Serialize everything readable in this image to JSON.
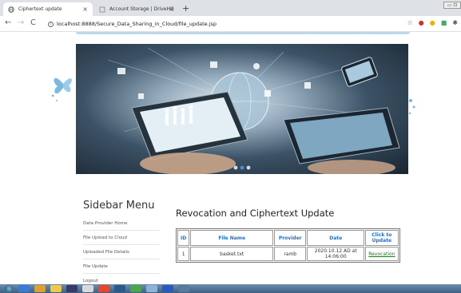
{
  "browser": {
    "tabs": [
      {
        "label": "Ciphertext update",
        "active": true
      },
      {
        "label": "Account Storage | DriveHQ",
        "active": false
      }
    ],
    "new_tab": "+",
    "url": "localhost:8888/Secure_Data_Sharing_in_Cloud/file_update.jsp",
    "window_controls": "▭ ⊡"
  },
  "sidebar": {
    "title": "Sidebar Menu",
    "items": [
      {
        "label": "Data Provider Home"
      },
      {
        "label": "File Upload to Cloud"
      },
      {
        "label": "Uploaded File Details"
      },
      {
        "label": "File Update"
      },
      {
        "label": "Logout"
      }
    ]
  },
  "main": {
    "title": "Revocation and Ciphertext Update",
    "table": {
      "headers": [
        "ID",
        "File Name",
        "Provider",
        "Date",
        "Click to Update"
      ],
      "rows": [
        {
          "id": "1",
          "file_name": "basket.txt",
          "provider": "ramb",
          "date": "2020.10.12 AD at 14:06:00",
          "action": "Revocation"
        }
      ]
    }
  },
  "colors": {
    "header_text": "#1f6fd1",
    "link": "#1a7a1a",
    "hero_dark": "#1a2631"
  },
  "icons": [
    "globe-icon",
    "close-icon",
    "back-icon",
    "forward-icon",
    "reload-icon",
    "info-icon",
    "star-icon",
    "extension-icon",
    "windows-start-icon"
  ]
}
